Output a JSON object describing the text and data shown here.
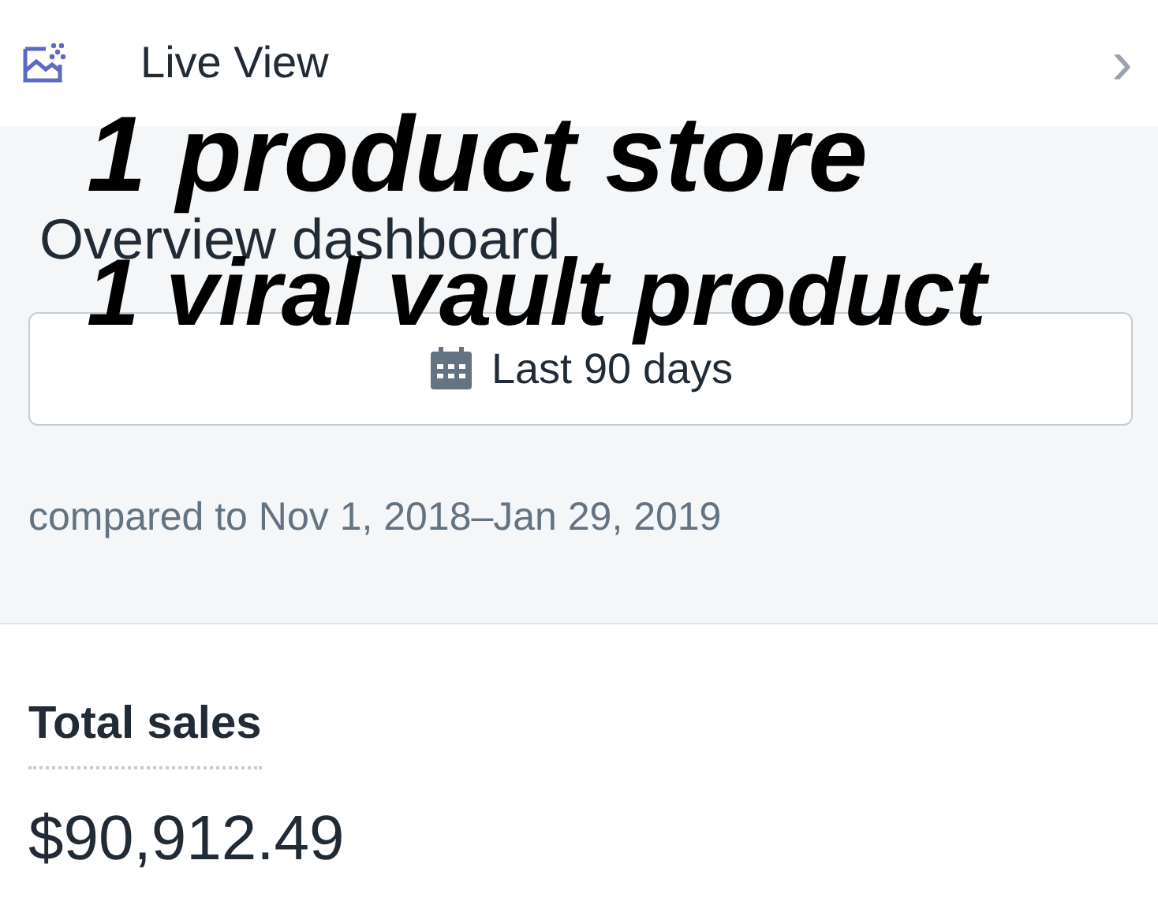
{
  "top_bar": {
    "label": "Live View",
    "chevron": "›"
  },
  "header": {
    "title": "Overview dashboard"
  },
  "date_button": {
    "label": "Last 90 days"
  },
  "comparison": "compared to Nov 1, 2018–Jan 29, 2019",
  "metric": {
    "label": "Total sales",
    "value": "$90,912.49"
  },
  "caption": [
    "1 product store",
    "1 viral vault product"
  ]
}
